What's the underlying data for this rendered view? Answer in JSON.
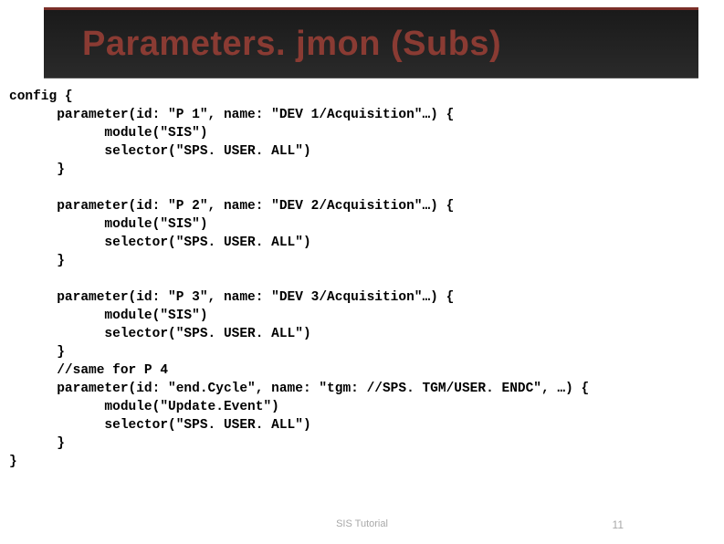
{
  "title": "Parameters. jmon (Subs)",
  "code": "config {\n      parameter(id: \"P 1\", name: \"DEV 1/Acquisition\"…) {\n            module(\"SIS\")\n            selector(\"SPS. USER. ALL\")\n      }\n\n      parameter(id: \"P 2\", name: \"DEV 2/Acquisition\"…) {\n            module(\"SIS\")\n            selector(\"SPS. USER. ALL\")\n      }\n\n      parameter(id: \"P 3\", name: \"DEV 3/Acquisition\"…) {\n            module(\"SIS\")\n            selector(\"SPS. USER. ALL\")\n      }\n      //same for P 4\n      parameter(id: \"end.Cycle\", name: \"tgm: //SPS. TGM/USER. ENDC\", …) {\n            module(\"Update.Event\")\n            selector(\"SPS. USER. ALL\")\n      }\n}",
  "footer_center": "SIS Tutorial",
  "footer_page": "11"
}
